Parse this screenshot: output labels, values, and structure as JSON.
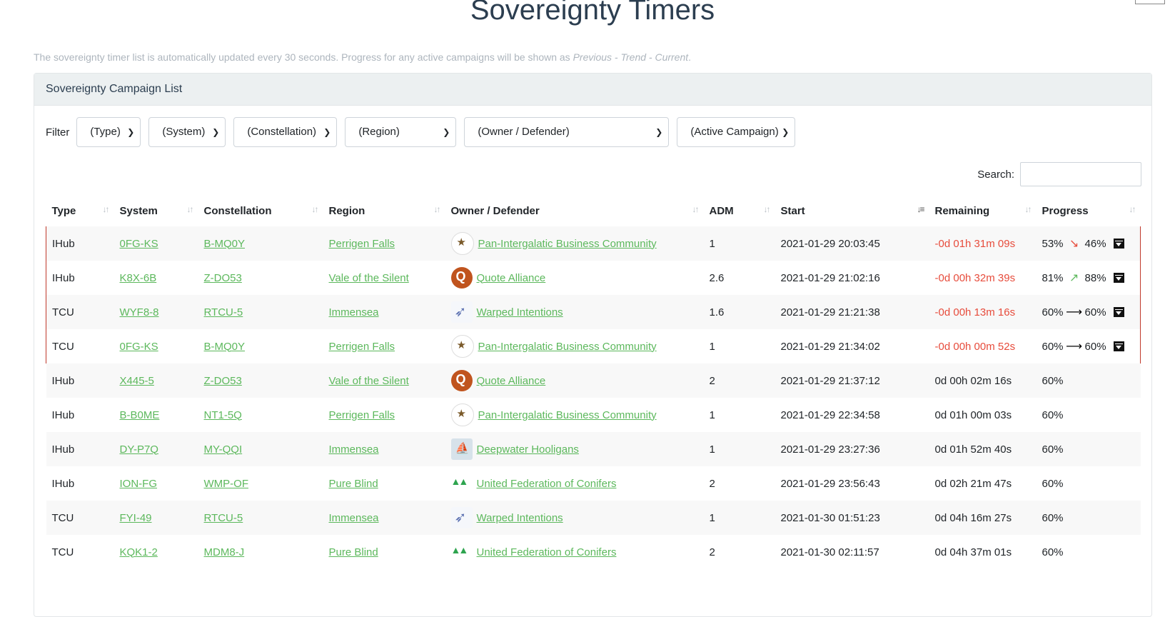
{
  "page": {
    "title": "Sovereignty Timers",
    "lead_text": "The sovereignty timer list is automatically updated every 30 seconds. Progress for any active campaigns will be shown as ",
    "lead_italic": "Previous - Trend - Current",
    "lead_end": "."
  },
  "card": {
    "header": "Sovereignty Campaign List"
  },
  "filter": {
    "label": "Filter",
    "selects": [
      "(Type)",
      "(System)",
      "(Constellation)",
      "(Region)",
      "(Owner / Defender)",
      "(Active Campaign)"
    ]
  },
  "search": {
    "label": "Search:",
    "value": ""
  },
  "table": {
    "columns": [
      "Type",
      "System",
      "Constellation",
      "Region",
      "Owner / Defender",
      "ADM",
      "Start",
      "Remaining",
      "Progress"
    ],
    "sorted_column": "Start",
    "rows": [
      {
        "type": "IHub",
        "system": "0FG-KS",
        "constellation": "B-MQ0Y",
        "region": "Perrigen Falls",
        "owner": "Pan-Intergalatic Business Community",
        "logo_icon": "pibc-logo",
        "adm": "1",
        "start": "2021-01-29 20:03:45",
        "remaining": "-0d 01h 31m 09s",
        "progress_prev": "53%",
        "trend": "down",
        "progress_cur": "46%",
        "active": true
      },
      {
        "type": "IHub",
        "system": "K8X-6B",
        "constellation": "Z-DO53",
        "region": "Vale of the Silent",
        "owner": "Quote Alliance",
        "logo_icon": "quote-logo",
        "adm": "2.6",
        "start": "2021-01-29 21:02:16",
        "remaining": "-0d 00h 32m 39s",
        "progress_prev": "81%",
        "trend": "up",
        "progress_cur": "88%",
        "active": true
      },
      {
        "type": "TCU",
        "system": "WYF8-8",
        "constellation": "RTCU-5",
        "region": "Immensea",
        "owner": "Warped Intentions",
        "logo_icon": "warped-logo",
        "adm": "1.6",
        "start": "2021-01-29 21:21:38",
        "remaining": "-0d 00h 13m 16s",
        "progress_prev": "60%",
        "trend": "flat",
        "progress_cur": "60%",
        "active": true
      },
      {
        "type": "TCU",
        "system": "0FG-KS",
        "constellation": "B-MQ0Y",
        "region": "Perrigen Falls",
        "owner": "Pan-Intergalatic Business Community",
        "logo_icon": "pibc-logo",
        "adm": "1",
        "start": "2021-01-29 21:34:02",
        "remaining": "-0d 00h 00m 52s",
        "progress_prev": "60%",
        "trend": "flat",
        "progress_cur": "60%",
        "active": true
      },
      {
        "type": "IHub",
        "system": "X445-5",
        "constellation": "Z-DO53",
        "region": "Vale of the Silent",
        "owner": "Quote Alliance",
        "logo_icon": "quote-logo",
        "adm": "2",
        "start": "2021-01-29 21:37:12",
        "remaining": "0d 00h 02m 16s",
        "progress_cur": "60%",
        "active": false
      },
      {
        "type": "IHub",
        "system": "B-B0ME",
        "constellation": "NT1-5Q",
        "region": "Perrigen Falls",
        "owner": "Pan-Intergalatic Business Community",
        "logo_icon": "pibc-logo",
        "adm": "1",
        "start": "2021-01-29 22:34:58",
        "remaining": "0d 01h 00m 03s",
        "progress_cur": "60%",
        "active": false
      },
      {
        "type": "IHub",
        "system": "DY-P7Q",
        "constellation": "MY-QQI",
        "region": "Immensea",
        "owner": "Deepwater Hooligans",
        "logo_icon": "deep-logo",
        "adm": "1",
        "start": "2021-01-29 23:27:36",
        "remaining": "0d 01h 52m 40s",
        "progress_cur": "60%",
        "active": false
      },
      {
        "type": "IHub",
        "system": "ION-FG",
        "constellation": "WMP-OF",
        "region": "Pure Blind",
        "owner": "United Federation of Conifers",
        "logo_icon": "conifers-logo",
        "adm": "2",
        "start": "2021-01-29 23:56:43",
        "remaining": "0d 02h 21m 47s",
        "progress_cur": "60%",
        "active": false
      },
      {
        "type": "TCU",
        "system": "FYI-49",
        "constellation": "RTCU-5",
        "region": "Immensea",
        "owner": "Warped Intentions",
        "logo_icon": "warped-logo",
        "adm": "1",
        "start": "2021-01-30 01:51:23",
        "remaining": "0d 04h 16m 27s",
        "progress_cur": "60%",
        "active": false
      },
      {
        "type": "TCU",
        "system": "KQK1-2",
        "constellation": "MDM8-J",
        "region": "Pure Blind",
        "owner": "United Federation of Conifers",
        "logo_icon": "conifers-logo",
        "adm": "2",
        "start": "2021-01-30 02:11:57",
        "remaining": "0d 04h 37m 01s",
        "progress_cur": "60%",
        "active": false
      }
    ]
  },
  "colors": {
    "link": "#5cb85c",
    "negative": "#e74c3c",
    "header_bg": "#ecf0f1",
    "active_border": "#c0392b"
  }
}
